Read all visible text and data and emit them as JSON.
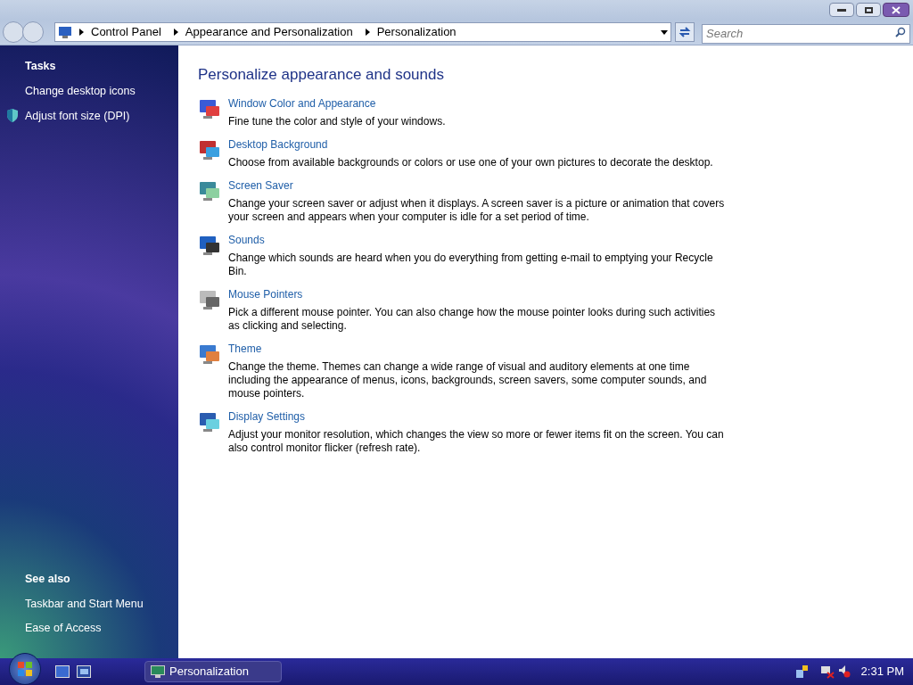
{
  "address_bar": {
    "breadcrumbs": [
      "Control Panel",
      "Appearance and Personalization",
      "Personalization"
    ]
  },
  "search": {
    "placeholder": "Search"
  },
  "sidebar": {
    "tasks_title": "Tasks",
    "tasks": [
      {
        "label": "Change desktop icons",
        "kind": "plain"
      },
      {
        "label": "Adjust font size (DPI)",
        "kind": "shield"
      }
    ],
    "see_also_title": "See also",
    "see_also": [
      "Taskbar and Start Menu",
      "Ease of Access"
    ]
  },
  "main": {
    "title": "Personalize appearance and sounds",
    "items": [
      {
        "title": "Window Color and Appearance",
        "description": "Fine tune the color and style of your windows."
      },
      {
        "title": "Desktop Background",
        "description": "Choose from available backgrounds or colors or use one of your own pictures to decorate the desktop."
      },
      {
        "title": "Screen Saver",
        "description": "Change your screen saver or adjust when it displays. A screen saver is a picture or animation that covers your screen and appears when your computer is idle for a set period of time."
      },
      {
        "title": "Sounds",
        "description": "Change which sounds are heard when you do everything from getting e-mail to emptying your Recycle Bin."
      },
      {
        "title": "Mouse Pointers",
        "description": "Pick a different mouse pointer. You can also change how the mouse pointer looks during such activities as clicking and selecting."
      },
      {
        "title": "Theme",
        "description": "Change the theme. Themes can change a wide range of visual and auditory elements at one time including the appearance of menus, icons, backgrounds, screen savers, some computer sounds, and mouse pointers."
      },
      {
        "title": "Display Settings",
        "description": "Adjust your monitor resolution, which changes the view so more or fewer items fit on the screen. You can also control monitor flicker (refresh rate)."
      }
    ]
  },
  "taskbar": {
    "tasks": [
      {
        "label": "Personalization",
        "selected": true
      }
    ],
    "clock": "2:31 PM"
  }
}
